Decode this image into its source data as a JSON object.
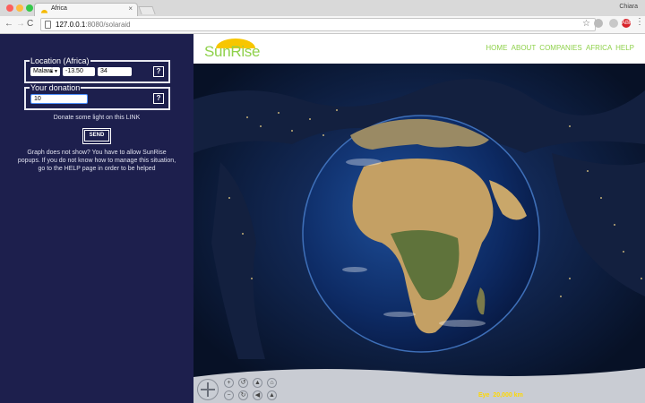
{
  "browser": {
    "tab_title": "Africa",
    "tab_close": "×",
    "profile_name": "Chiara",
    "url_host": "127.0.0.1",
    "url_path": ":8080/solaraid",
    "back": "←",
    "forward": "→",
    "reload": "C",
    "star": "☆",
    "menu": "⋮",
    "ext3_label": "ABP"
  },
  "sidebar": {
    "location_legend": "Location (Africa)",
    "country_value": "Malawi",
    "country_arrows": "▲▼",
    "latitude_value": "-13.50",
    "longitude_value": "34",
    "help_label": "?",
    "donation_legend": "Your donation",
    "donation_value": "10",
    "donate_text": "Donate some light on this LINK",
    "send_label": "SEND",
    "info_text": "Graph does not show? You have to allow SunRise popups. If you do not know how to manage this situation, go to the HELP page in order to be helped"
  },
  "site": {
    "logo_text": "SunRise",
    "nav": [
      "HOME",
      "ABOUT",
      "COMPANIES",
      "AFRICA",
      "HELP"
    ]
  },
  "globe": {
    "eye_label": "Eye",
    "eye_value": "20,000 km",
    "control_icons": [
      "+",
      "↺",
      "▲",
      "⌂",
      "−",
      "↻",
      "◀",
      "▲"
    ]
  },
  "colors": {
    "panel_bg": "#1d1f4d",
    "brand_green": "#8fd14b",
    "eye_yellow": "#ffd800",
    "ocean": "#0d2a63",
    "land": "#b99a5c"
  }
}
